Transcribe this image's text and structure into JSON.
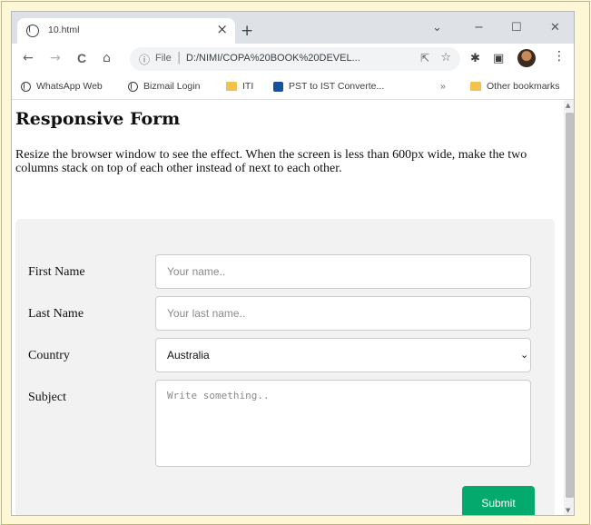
{
  "browser": {
    "tab_title": "10.html",
    "tab_close": "×",
    "new_tab": "+",
    "window_controls": {
      "minimize": "−",
      "maximize": "☐",
      "close": "✕",
      "tab_search": "⌄"
    },
    "nav": {
      "back": "←",
      "forward": "→",
      "reload": "C",
      "home": "⌂"
    },
    "omnibox": {
      "info": "ⓘ",
      "scheme": "File",
      "separator": "|",
      "url": "D:/NIMI/COPA%20BOOK%20DEVEL...",
      "share": "⇱",
      "star": "☆"
    },
    "extensions": {
      "puzzle": "✱",
      "sidepanel": "▣",
      "menu": "⋮"
    },
    "bookmarks": [
      {
        "label": "WhatsApp Web",
        "icon": "globe-icon"
      },
      {
        "label": "Bizmail Login",
        "icon": "globe-icon"
      },
      {
        "label": "ITI",
        "icon": "folder-icon"
      },
      {
        "label": "PST to IST Converte...",
        "icon": "app-icon"
      }
    ],
    "bookmarks_overflow": "»",
    "other_bookmarks": "Other bookmarks"
  },
  "page": {
    "heading": "Responsive Form",
    "description": "Resize the browser window to see the effect. When the screen is less than 600px wide, make the two columns stack on top of each other instead of next to each other.",
    "form": {
      "first_name_label": "First Name",
      "first_name_placeholder": "Your name..",
      "last_name_label": "Last Name",
      "last_name_placeholder": "Your last name..",
      "country_label": "Country",
      "country_selected": "Australia",
      "subject_label": "Subject",
      "subject_placeholder": "Write something..",
      "submit_label": "Submit"
    }
  },
  "colors": {
    "submit_bg": "#04aa6d",
    "form_bg": "#f2f2f2",
    "tabstrip_bg": "#dee1e6"
  }
}
